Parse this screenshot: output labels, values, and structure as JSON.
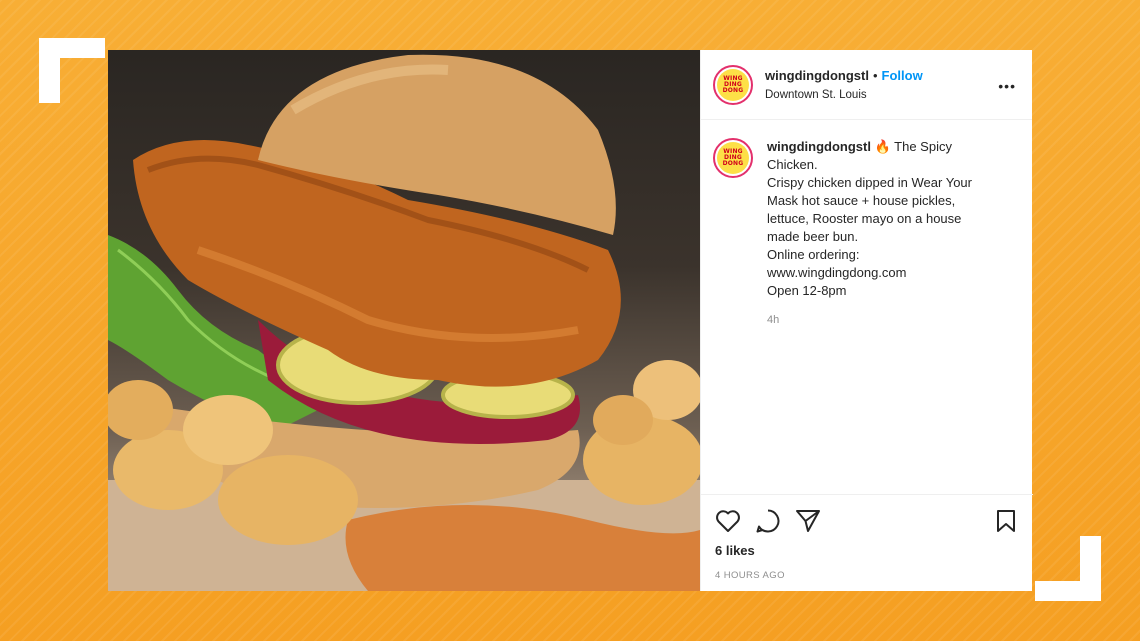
{
  "post": {
    "username": "wingdingdongstl",
    "follow_label": "Follow",
    "separator": "•",
    "location": "Downtown St. Louis",
    "more_label": "•••",
    "avatar_text": [
      "WING",
      "DING",
      "DONG"
    ],
    "caption_username": "wingdingdongstl",
    "caption_emoji": "🔥",
    "caption_text": " The Spicy Chicken.\nCrispy chicken dipped in Wear Your Mask hot sauce + house pickles, lettuce, Rooster mayo on a house made beer bun.\nOnline ordering:\nwww.wingdingdong.com\nOpen 12-8pm",
    "caption_age": "4h",
    "likes": "6 likes",
    "timestamp": "4 HOURS AGO"
  },
  "icons": {
    "like": "heart-icon",
    "comment": "comment-icon",
    "share": "share-icon",
    "save": "bookmark-icon"
  },
  "colors": {
    "background": "#f7a52c",
    "follow": "#0095f6",
    "avatar_ring": "#e3306c",
    "avatar_fill": "#fde047"
  }
}
